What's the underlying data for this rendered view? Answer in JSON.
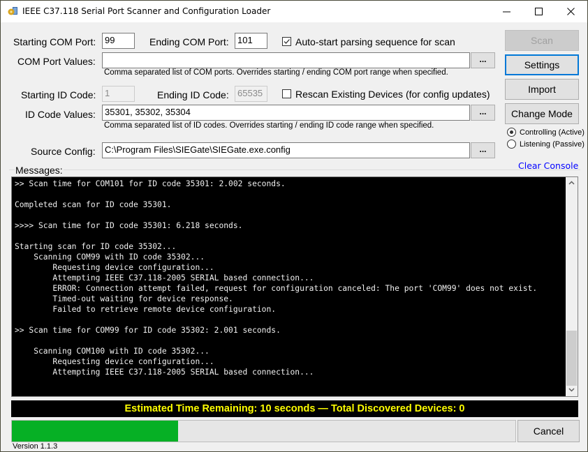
{
  "window": {
    "title": "IEEE C37.118 Serial Port Scanner and Configuration Loader",
    "icon": "gear-app-icon",
    "controls": {
      "minimize": "—",
      "maximize": "☐",
      "close": "✕"
    }
  },
  "com": {
    "start_label": "Starting COM Port:",
    "start_value": "99",
    "end_label": "Ending COM Port:",
    "end_value": "101",
    "autostart_label": "Auto-start parsing sequence for scan",
    "autostart_checked": true,
    "values_label": "COM Port Values:",
    "values_value": "",
    "values_hint": "Comma separated list of COM ports. Overrides starting / ending COM port range when specified.",
    "browse_label": "..."
  },
  "id": {
    "start_label": "Starting ID Code:",
    "start_value": "1",
    "end_label": "Ending ID Code:",
    "end_value": "65535",
    "rescan_label": "Rescan Existing Devices (for config updates)",
    "rescan_checked": false,
    "values_label": "ID Code Values:",
    "values_value": "35301, 35302, 35304",
    "values_hint": "Comma separated list of ID codes. Overrides starting / ending ID code range when specified.",
    "browse_label": "..."
  },
  "source": {
    "label": "Source Config:",
    "value": "C:\\Program Files\\SIEGate\\SIEGate.exe.config",
    "browse_label": "..."
  },
  "side_buttons": {
    "scan": "Scan",
    "settings": "Settings",
    "import": "Import",
    "change_mode": "Change Mode"
  },
  "mode": {
    "controlling_label": "Controlling (Active)",
    "listening_label": "Listening (Passive)",
    "selected": "controlling"
  },
  "messages": {
    "label": "Messages:",
    "clear_label": "Clear Console",
    "lines": [
      ">> Scan time for COM101 for ID code 35301: 2.002 seconds.",
      "",
      "Completed scan for ID code 35301.",
      "",
      ">>>> Scan time for ID code 35301: 6.218 seconds.",
      "",
      "Starting scan for ID code 35302...",
      "    Scanning COM99 with ID code 35302...",
      "        Requesting device configuration...",
      "        Attempting IEEE C37.118-2005 SERIAL based connection...",
      "        ERROR: Connection attempt failed, request for configuration canceled: The port 'COM99' does not exist.",
      "        Timed-out waiting for device response.",
      "        Failed to retrieve remote device configuration.",
      "",
      ">> Scan time for COM99 for ID code 35302: 2.001 seconds.",
      "",
      "    Scanning COM100 with ID code 35302...",
      "        Requesting device configuration...",
      "        Attempting IEEE C37.118-2005 SERIAL based connection..."
    ],
    "scroll_up": "˄",
    "scroll_down": "˅"
  },
  "status": {
    "text": "Estimated Time Remaining: 10 seconds — Total Discovered Devices: 0"
  },
  "progress": {
    "percent": 33,
    "color": "#06b025"
  },
  "cancel_label": "Cancel",
  "version": "Version 1.1.3"
}
